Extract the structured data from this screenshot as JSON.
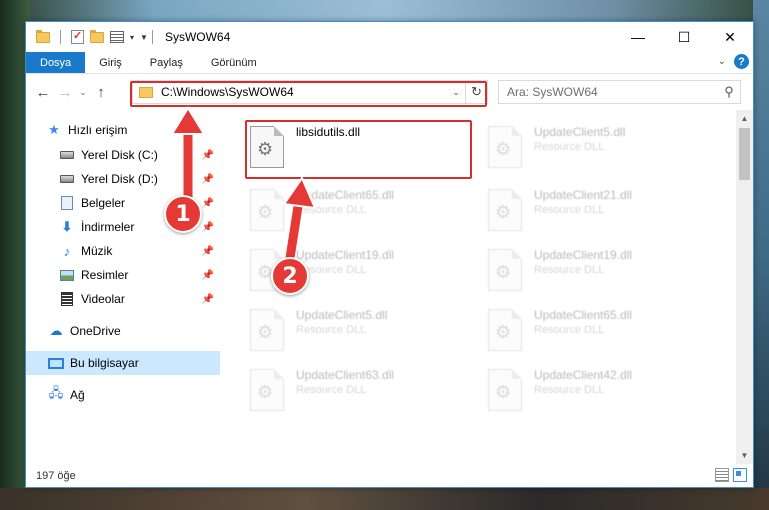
{
  "window": {
    "title": "SysWOW64",
    "controls": {
      "minimize": "—",
      "maximize": "☐",
      "close": "✕"
    }
  },
  "ribbon": {
    "tabs": [
      {
        "label": "Dosya"
      },
      {
        "label": "Giriş"
      },
      {
        "label": "Paylaş"
      },
      {
        "label": "Görünüm"
      }
    ],
    "help_label": "?"
  },
  "address": {
    "path": "C:\\Windows\\SysWOW64",
    "search_placeholder": "Ara: SysWOW64"
  },
  "nav_pane": {
    "items": [
      {
        "label": "Hızlı erişim",
        "icon": "star-icon",
        "pinned": false
      },
      {
        "label": "Yerel Disk (C:)",
        "icon": "drive-icon",
        "pinned": true
      },
      {
        "label": "Yerel Disk (D:)",
        "icon": "drive-icon",
        "pinned": true
      },
      {
        "label": "Belgeler",
        "icon": "documents-icon",
        "pinned": true
      },
      {
        "label": "İndirmeler",
        "icon": "downloads-icon",
        "pinned": true
      },
      {
        "label": "Müzik",
        "icon": "music-icon",
        "pinned": true
      },
      {
        "label": "Resimler",
        "icon": "pictures-icon",
        "pinned": true
      },
      {
        "label": "Videolar",
        "icon": "videos-icon",
        "pinned": true
      },
      {
        "label": "OneDrive",
        "icon": "onedrive-icon",
        "pinned": false
      },
      {
        "label": "Bu bilgisayar",
        "icon": "this-pc-icon",
        "pinned": false,
        "selected": true
      },
      {
        "label": "Ağ",
        "icon": "network-icon",
        "pinned": false
      }
    ]
  },
  "files": {
    "highlighted": {
      "name": "libsidutils.dll",
      "type": ""
    },
    "others": [
      {
        "name": "UpdateClient5.dll",
        "type": "Resource DLL"
      },
      {
        "name": "UpdateClient65.dll",
        "type": "Resource DLL"
      },
      {
        "name": "UpdateClient21.dll",
        "type": "Resource DLL"
      },
      {
        "name": "UpdateClient19.dll",
        "type": "Resource DLL"
      },
      {
        "name": "UpdateClient19.dll",
        "type": "Resource DLL"
      },
      {
        "name": "UpdateClient5.dll",
        "type": "Resource DLL"
      },
      {
        "name": "UpdateClient65.dll",
        "type": "Resource DLL"
      },
      {
        "name": "UpdateClient63.dll",
        "type": "Resource DLL"
      },
      {
        "name": "UpdateClient42.dll",
        "type": "Resource DLL"
      }
    ]
  },
  "status": {
    "item_count": "197 öğe"
  },
  "annotations": {
    "step1": "1",
    "step2": "2",
    "highlight_color": "#d32f2f",
    "badge_color": "#e53935"
  },
  "colors": {
    "accent": "#1979ca",
    "selection": "#cce8ff"
  }
}
